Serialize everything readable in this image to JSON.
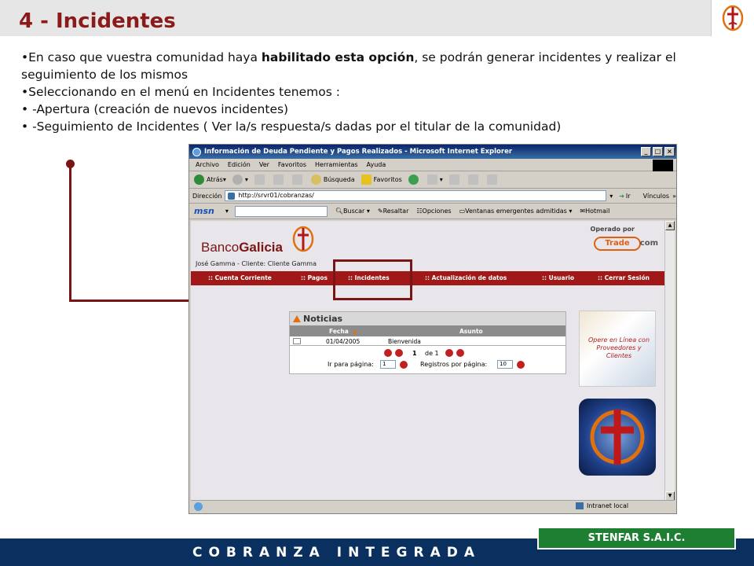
{
  "slide": {
    "title": "4 - Incidentes",
    "bullets": {
      "b1_pre": "•En caso que vuestra comunidad haya ",
      "b1_bold": "habilitado esta opción",
      "b1_post": ", se podrán generar incidentes y realizar el seguimiento de los mismos",
      "b2": "•Seleccionando en el menú en Incidentes tenemos :",
      "b3": "• -Apertura (creación de nuevos incidentes)",
      "b4": "• -Seguimiento de Incidentes ( Ver la/s respuesta/s dadas por el titular de la comunidad)"
    },
    "footer": "COBRANZA INTEGRADA",
    "company": "STENFAR S.A.I.C."
  },
  "browser": {
    "title": "Información de Deuda Pendiente y Pagos Realizados - Microsoft Internet Explorer",
    "menu": [
      "Archivo",
      "Edición",
      "Ver",
      "Favoritos",
      "Herramientas",
      "Ayuda"
    ],
    "toolbar": {
      "back": "Atrás",
      "search": "Búsqueda",
      "favorites": "Favoritos"
    },
    "address_label": "Dirección",
    "address": "http://srvr01/cobranzas/",
    "go": "Ir",
    "links": "Vínculos",
    "msn": "msn",
    "msn_toolbar": [
      "Buscar",
      "Resaltar",
      "Opciones",
      "Ventanas emergentes admitidas",
      "Hotmail"
    ],
    "status_zone": "Intranet local"
  },
  "page": {
    "bank_name_pre": "Banco",
    "bank_name_bold": "Galicia",
    "operated_by": "Operado por",
    "trade": "Trade",
    "trade_com": "com",
    "user_line": "José Gamma - Cliente: Cliente Gamma",
    "nav": [
      ":: Cuenta Corriente",
      ":: Pagos",
      ":: Incidentes",
      ":: Actualización de datos",
      ":: Usuario",
      ":: Cerrar Sesión"
    ],
    "news": {
      "title": "Noticias",
      "columns": [
        "Fecha",
        "Asunto"
      ],
      "rows": [
        {
          "fecha": "01/04/2005",
          "asunto": "Bienvenida"
        }
      ],
      "page_current": "1",
      "page_of": "de 1",
      "goto_label": "Ir para página:",
      "goto_value": "1",
      "per_page_label": "Registros por página:",
      "per_page_value": "10"
    },
    "ad_text": "Opere en Línea con Proveedores y Clientes"
  }
}
